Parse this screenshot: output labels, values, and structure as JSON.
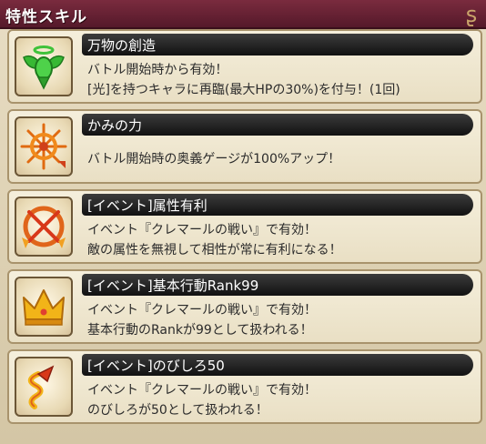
{
  "header": {
    "title": "特性スキル"
  },
  "skills": [
    {
      "icon": "winged-orb-icon",
      "name": "万物の創造",
      "desc": [
        "バトル開始時から有効！",
        "[光]を持つキャラに再臨(最大HPの30%)を付与！(1回)"
      ]
    },
    {
      "icon": "compass-arrows-icon",
      "name": "かみの力",
      "desc": [
        "バトル開始時の奥義ゲージが100%アップ！"
      ]
    },
    {
      "icon": "crossed-arrows-circle-icon",
      "name": "[イベント]属性有利",
      "desc": [
        "イベント『クレマールの戦い』で有効！",
        "敵の属性を無視して相性が常に有利になる！"
      ]
    },
    {
      "icon": "crown-icon",
      "name": "[イベント]基本行動Rank99",
      "desc": [
        "イベント『クレマールの戦い』で有効！",
        "基本行動のRankが99として扱われる！"
      ]
    },
    {
      "icon": "spring-arrow-icon",
      "name": "[イベント]のびしろ50",
      "desc": [
        "イベント『クレマールの戦い』で有効！",
        "のびしろが50として扱われる！"
      ]
    }
  ]
}
